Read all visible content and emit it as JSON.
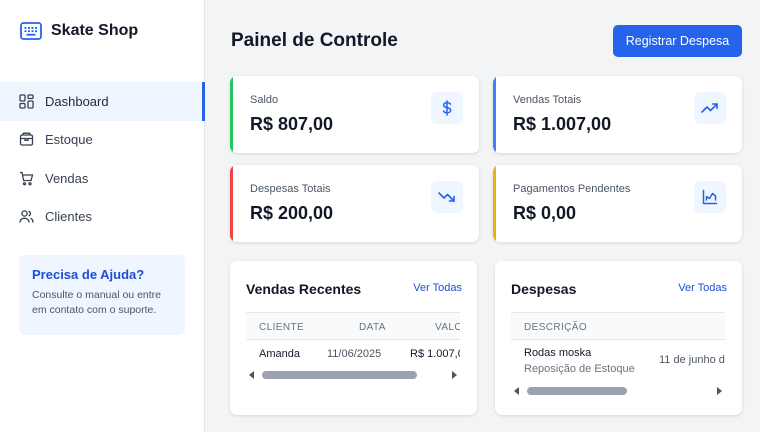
{
  "app": {
    "name": "Skate Shop"
  },
  "sidebar": {
    "items": [
      {
        "label": "Dashboard",
        "icon": "dashboard-icon",
        "active": true
      },
      {
        "label": "Estoque",
        "icon": "box-icon",
        "active": false
      },
      {
        "label": "Vendas",
        "icon": "cart-icon",
        "active": false
      },
      {
        "label": "Clientes",
        "icon": "users-icon",
        "active": false
      }
    ],
    "help": {
      "title": "Precisa de Ajuda?",
      "text": "Consulte o manual ou entre em contato com o suporte."
    }
  },
  "header": {
    "title": "Painel de Controle",
    "action_label": "Registrar Despesa"
  },
  "stats": [
    {
      "label": "Saldo",
      "value": "R$ 807,00",
      "icon": "dollar-icon",
      "accent": "#22c55e"
    },
    {
      "label": "Vendas Totais",
      "value": "R$ 1.007,00",
      "icon": "trending-up-icon",
      "accent": "#3b82f6"
    },
    {
      "label": "Despesas Totais",
      "value": "R$ 200,00",
      "icon": "trending-down-icon",
      "accent": "#ef4444"
    },
    {
      "label": "Pagamentos Pendentes",
      "value": "R$ 0,00",
      "icon": "chart-icon",
      "accent": "#eab308"
    }
  ],
  "recent_sales": {
    "title": "Vendas Recentes",
    "link": "Ver Todas",
    "columns": [
      "CLIENTE",
      "DATA",
      "VALO"
    ],
    "rows": [
      {
        "cliente": "Amanda",
        "data": "11/06/2025",
        "valor": "R$ 1.007,0"
      }
    ],
    "scroll_fraction": 0.85
  },
  "expenses": {
    "title": "Despesas",
    "link": "Ver Todas",
    "columns": [
      "DESCRIÇÃO"
    ],
    "rows": [
      {
        "descricao": "Rodas moska",
        "categoria": "Reposição de Estoque",
        "data": "11 de junho d"
      }
    ],
    "scroll_fraction": 0.55
  },
  "colors": {
    "primary": "#2563eb",
    "primary_light": "#eff6ff"
  }
}
